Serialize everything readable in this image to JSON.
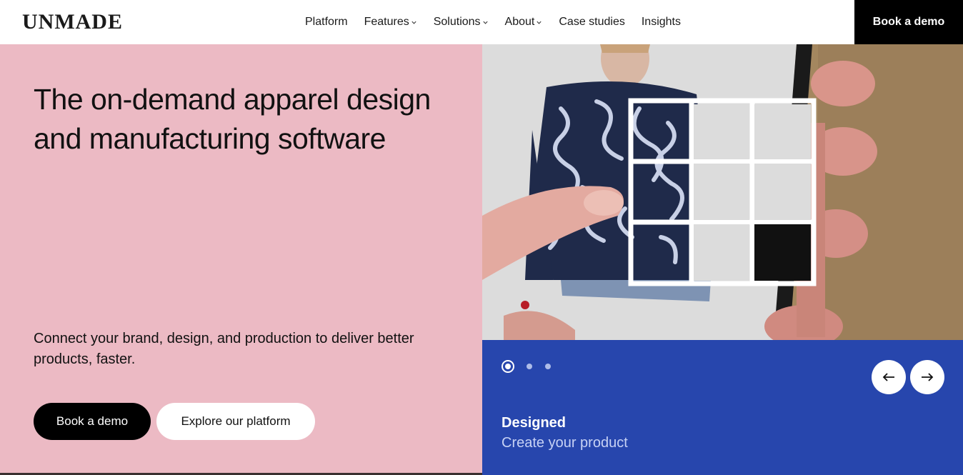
{
  "brand": {
    "logo": "UNMADE"
  },
  "nav": {
    "items": [
      {
        "label": "Platform",
        "dropdown": false
      },
      {
        "label": "Features",
        "dropdown": true
      },
      {
        "label": "Solutions",
        "dropdown": true
      },
      {
        "label": "About",
        "dropdown": true
      },
      {
        "label": "Case studies",
        "dropdown": false
      },
      {
        "label": "Insights",
        "dropdown": false
      }
    ],
    "cta": "Book a demo"
  },
  "hero": {
    "title": "The on-demand apparel design and manufacturing software",
    "subtitle": "Connect your brand, design, and production to deliver better products, faster.",
    "primary_button": "Book a demo",
    "secondary_button": "Explore our platform",
    "background_color": "#ecbac4"
  },
  "carousel": {
    "slides_total": 3,
    "active_index": 0,
    "title": "Designed",
    "subtitle": "Create your product",
    "panel_color": "#2746ad",
    "prev_icon": "arrow-left-icon",
    "next_icon": "arrow-right-icon"
  }
}
